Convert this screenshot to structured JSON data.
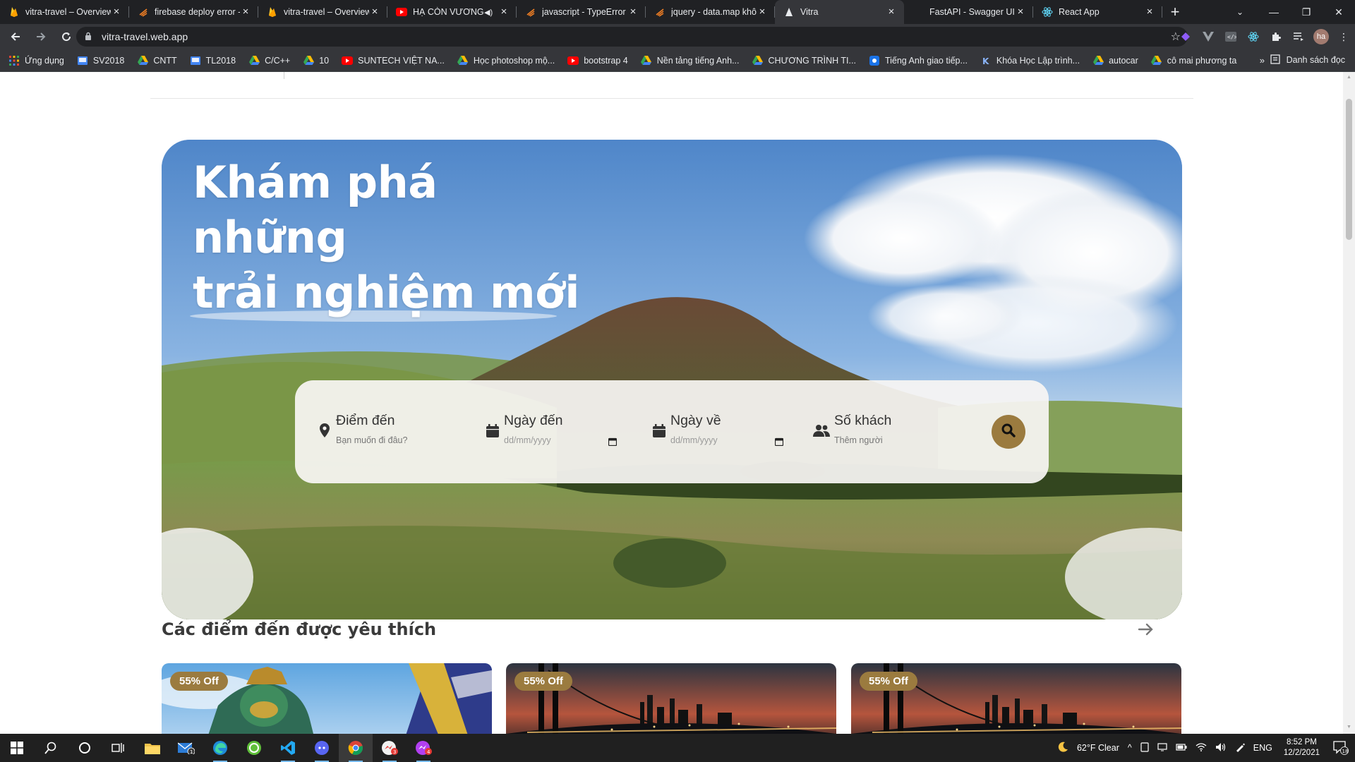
{
  "browser": {
    "tabs": [
      {
        "title": "vitra-travel – Overview",
        "icon": "firebase-icon",
        "active": false
      },
      {
        "title": "firebase deploy error - ",
        "icon": "firebase-icon",
        "active": false
      },
      {
        "title": "vitra-travel – Overview",
        "icon": "firebase-icon",
        "active": false
      },
      {
        "title": "HẠ CÒN VƯƠNG",
        "icon": "youtube-icon",
        "active": false,
        "audio": true
      },
      {
        "title": "javascript - TypeError",
        "icon": "stackoverflow-icon",
        "active": false
      },
      {
        "title": "jquery - data.map khô",
        "icon": "stackoverflow-icon",
        "active": false
      },
      {
        "title": "Vitra",
        "icon": "vitra-icon",
        "active": true
      },
      {
        "title": "FastAPI - Swagger UI",
        "icon": "blank-icon",
        "active": false
      },
      {
        "title": "React App",
        "icon": "react-icon",
        "active": false
      }
    ],
    "url": "vitra-travel.web.app",
    "profile_initials": "ha",
    "bookmarks": [
      {
        "label": "Ứng dụng",
        "icon": "apps-grid-icon"
      },
      {
        "label": "SV2018",
        "icon": "classroom-icon"
      },
      {
        "label": "CNTT",
        "icon": "drive-icon"
      },
      {
        "label": "TL2018",
        "icon": "classroom-icon"
      },
      {
        "label": "C/C++",
        "icon": "drive-icon"
      },
      {
        "label": "10",
        "icon": "drive-icon"
      },
      {
        "label": "SUNTECH VIỆT NA...",
        "icon": "youtube-icon"
      },
      {
        "label": "Học photoshop mộ...",
        "icon": "drive-icon"
      },
      {
        "label": "bootstrap 4",
        "icon": "youtube-icon"
      },
      {
        "label": "Nền tảng tiếng Anh...",
        "icon": "drive-icon"
      },
      {
        "label": "CHƯƠNG TRÌNH TI...",
        "icon": "drive-icon"
      },
      {
        "label": "Tiếng Anh giao tiếp...",
        "icon": "site-icon"
      },
      {
        "label": "Khóa Học Lập trình...",
        "icon": "k-site-icon"
      },
      {
        "label": "autocar",
        "icon": "drive-icon"
      },
      {
        "label": "cô mai phương ta",
        "icon": "drive-icon"
      }
    ],
    "bookmarks_more": "»",
    "reading_list": "Danh sách đọc"
  },
  "hero": {
    "title_lines": [
      "Khám phá",
      "những",
      "trải nghiệm mới"
    ]
  },
  "search": {
    "destination": {
      "label": "Điểm đến",
      "placeholder": "Bạn muốn đi đâu?"
    },
    "checkin": {
      "label": "Ngày đến",
      "placeholder": "dd/mm/yyyy"
    },
    "checkout": {
      "label": "Ngày về",
      "placeholder": "dd/mm/yyyy"
    },
    "guests": {
      "label": "Số khách",
      "placeholder": "Thêm người"
    }
  },
  "popular": {
    "title": "Các điểm đến được yêu thích",
    "cards": [
      {
        "badge": "55% Off",
        "image": "temple-guardian-statue"
      },
      {
        "badge": "55% Off",
        "image": "city-bridge-night"
      },
      {
        "badge": "55% Off",
        "image": "city-bridge-night"
      }
    ]
  },
  "taskbar": {
    "weather": "62°F  Clear",
    "language": "ENG",
    "time": "8:52 PM",
    "date": "12/2/2021",
    "notification_count": "18",
    "mail_badge": "1",
    "badge_3": "3",
    "badge_4": "4"
  },
  "colors": {
    "accent": "#9b7b3f",
    "chrome_dark": "#202124",
    "chrome_toolbar": "#35363a"
  }
}
